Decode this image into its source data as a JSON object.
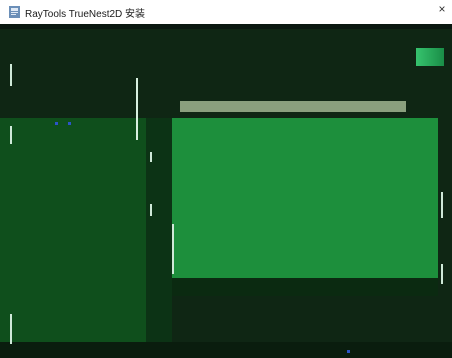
{
  "window": {
    "title": "RayTools TrueNest2D 安装",
    "close_glyph": "×",
    "app_icon": "installer-icon"
  },
  "colors": {
    "body_bg": "#0f2614",
    "left_panel": "#0f4f1c",
    "right_panel": "#1d8f3c",
    "license_bar": "#8aa07e",
    "accent_blue": "#2c54c8"
  }
}
